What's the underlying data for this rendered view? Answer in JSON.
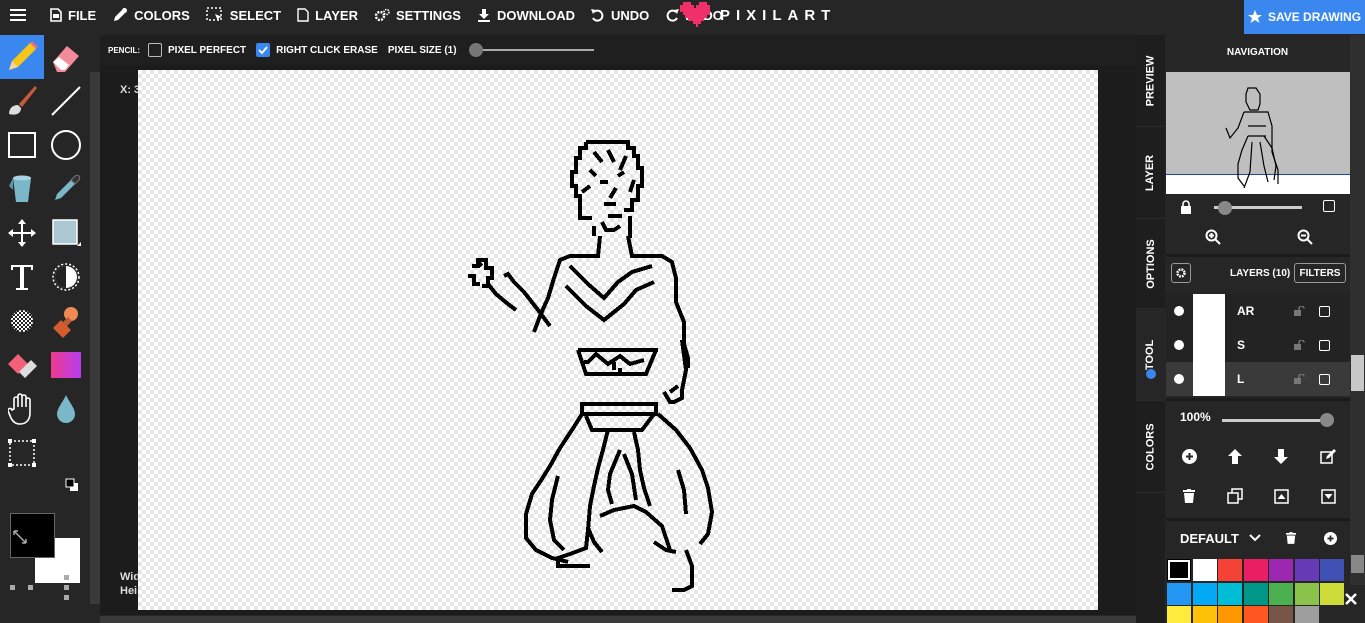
{
  "topbar": {
    "menu": [
      {
        "label": "FILE",
        "icon": "file-icon"
      },
      {
        "label": "COLORS",
        "icon": "eyedropper-icon"
      },
      {
        "label": "SELECT",
        "icon": "select-icon"
      },
      {
        "label": "LAYER",
        "icon": "layer-icon"
      },
      {
        "label": "SETTINGS",
        "icon": "gears-icon"
      },
      {
        "label": "DOWNLOAD",
        "icon": "download-icon"
      },
      {
        "label": "UNDO",
        "icon": "undo-icon"
      },
      {
        "label": "REDO",
        "icon": "redo-icon"
      }
    ],
    "logo": "PIXILART",
    "save_label": "SAVE DRAWING"
  },
  "options": {
    "tool_label": "PENCIL:",
    "pixel_perfect": {
      "label": "PIXEL PERFECT",
      "checked": false
    },
    "right_click_erase": {
      "label": "RIGHT CLICK ERASE",
      "checked": true
    },
    "pixel_size": {
      "label": "PIXEL SIZE (1)",
      "value": 1
    }
  },
  "canvas": {
    "coord_readout": "X: 3",
    "width_readout": "Wid",
    "height_readout": "Hei"
  },
  "side_tabs": [
    "PREVIEW",
    "LAYER",
    "OPTIONS",
    "TOOL",
    "COLORS"
  ],
  "navigation": {
    "title": "NAVIGATION"
  },
  "layers": {
    "title": "LAYERS (10)",
    "filters_label": "FILTERS",
    "items": [
      {
        "name": "AR",
        "selected": false
      },
      {
        "name": "S",
        "selected": false
      },
      {
        "name": "L",
        "selected": true
      }
    ],
    "opacity": "100%"
  },
  "palette": {
    "name": "DEFAULT",
    "colors": [
      "#000000",
      "#ffffff",
      "#f44336",
      "#e91e63",
      "#9c27b0",
      "#673ab7",
      "#3f51b5",
      "#2196f3",
      "#03a9f4",
      "#00bcd4",
      "#009688",
      "#4caf50",
      "#8bc34a",
      "#cddc39",
      "#ffeb3b",
      "#ffc107",
      "#ff9800",
      "#ff5722",
      "#795548",
      "#9e9e9e"
    ]
  },
  "colors": {
    "primary": "#000000",
    "secondary": "#ffffff",
    "accent": "#3a87f0"
  }
}
